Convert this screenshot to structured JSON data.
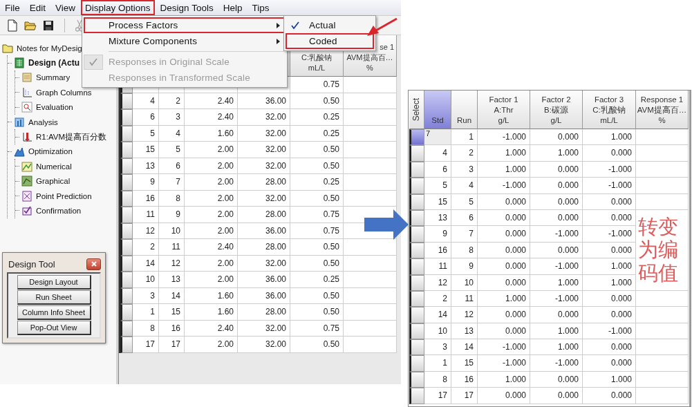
{
  "menu_bar": [
    {
      "label": "File",
      "outlined": false
    },
    {
      "label": "Edit",
      "outlined": false
    },
    {
      "label": "View",
      "outlined": false
    },
    {
      "label": "Display Options",
      "outlined": true
    },
    {
      "label": "Design Tools",
      "outlined": false
    },
    {
      "label": "Help",
      "outlined": false
    },
    {
      "label": "Tips",
      "outlined": false
    }
  ],
  "tree": [
    {
      "label": "Notes for MyDesig",
      "active": false,
      "children": [
        {
          "label": "Design (Actu",
          "active": true,
          "children": [
            {
              "label": "Summary",
              "active": false
            },
            {
              "label": "Graph Columns",
              "active": false
            },
            {
              "label": "Evaluation",
              "active": false
            }
          ]
        },
        {
          "label": "Analysis",
          "active": false,
          "children": [
            {
              "label": "R1:AVM提高百分数",
              "active": false
            }
          ]
        },
        {
          "label": "Optimization",
          "active": false,
          "children": [
            {
              "label": "Numerical",
              "active": false
            },
            {
              "label": "Graphical",
              "active": false
            },
            {
              "label": "Point Prediction",
              "active": false
            },
            {
              "label": "Confirmation",
              "active": false
            }
          ]
        }
      ]
    }
  ],
  "design_tool": {
    "title": "Design Tool",
    "buttons": [
      "Design Layout",
      "Run Sheet",
      "Column Info Sheet",
      "Pop-Out View"
    ]
  },
  "grid": {
    "header": {
      "factor_3": [
        "C:乳酸钠",
        "mL/L"
      ],
      "response_1": [
        "se 1",
        "AVM提高百…",
        "%"
      ]
    },
    "rows": [
      {
        "factor_3": "0.75",
        "selected": false
      },
      {
        "std": "4",
        "run": "2",
        "factor_1": "2.40",
        "factor_2": "36.00",
        "factor_3": "0.50",
        "selected": false
      },
      {
        "std": "6",
        "run": "3",
        "factor_1": "2.40",
        "factor_2": "32.00",
        "factor_3": "0.25",
        "selected": false
      },
      {
        "std": "5",
        "run": "4",
        "factor_1": "1.60",
        "factor_2": "32.00",
        "factor_3": "0.25",
        "selected": false
      },
      {
        "std": "15",
        "run": "5",
        "factor_1": "2.00",
        "factor_2": "32.00",
        "factor_3": "0.50",
        "selected": false
      },
      {
        "std": "13",
        "run": "6",
        "factor_1": "2.00",
        "factor_2": "32.00",
        "factor_3": "0.50",
        "selected": false
      },
      {
        "std": "9",
        "run": "7",
        "factor_1": "2.00",
        "factor_2": "28.00",
        "factor_3": "0.25",
        "selected": false
      },
      {
        "std": "16",
        "run": "8",
        "factor_1": "2.00",
        "factor_2": "32.00",
        "factor_3": "0.50",
        "selected": false
      },
      {
        "std": "11",
        "run": "9",
        "factor_1": "2.00",
        "factor_2": "28.00",
        "factor_3": "0.75",
        "selected": false
      },
      {
        "std": "12",
        "run": "10",
        "factor_1": "2.00",
        "factor_2": "36.00",
        "factor_3": "0.75",
        "selected": false
      },
      {
        "std": "2",
        "run": "11",
        "factor_1": "2.40",
        "factor_2": "28.00",
        "factor_3": "0.50",
        "selected": false
      },
      {
        "std": "14",
        "run": "12",
        "factor_1": "2.00",
        "factor_2": "32.00",
        "factor_3": "0.50",
        "selected": false
      },
      {
        "std": "10",
        "run": "13",
        "factor_1": "2.00",
        "factor_2": "36.00",
        "factor_3": "0.25",
        "selected": false
      },
      {
        "std": "3",
        "run": "14",
        "factor_1": "1.60",
        "factor_2": "36.00",
        "factor_3": "0.50",
        "selected": false
      },
      {
        "std": "1",
        "run": "15",
        "factor_1": "1.60",
        "factor_2": "28.00",
        "factor_3": "0.50",
        "selected": false
      },
      {
        "std": "8",
        "run": "16",
        "factor_1": "2.40",
        "factor_2": "32.00",
        "factor_3": "0.75",
        "selected": false
      },
      {
        "std": "17",
        "run": "17",
        "factor_1": "2.00",
        "factor_2": "32.00",
        "factor_3": "0.50",
        "selected": false
      }
    ]
  },
  "menu": {
    "items": [
      {
        "kind": "item",
        "label": "Process Factors",
        "submenu": true,
        "checked": false,
        "disabled": false,
        "outlined": true
      },
      {
        "kind": "item",
        "label": "Mixture Components",
        "submenu": true,
        "checked": false,
        "disabled": false,
        "outlined": false
      },
      {
        "kind": "separator"
      },
      {
        "kind": "item",
        "label": "Responses in Original Scale",
        "submenu": false,
        "checked": true,
        "disabled": true,
        "outlined": false
      },
      {
        "kind": "item",
        "label": "Responses in Transformed Scale",
        "submenu": false,
        "checked": false,
        "disabled": true,
        "outlined": false
      }
    ]
  },
  "submenu": {
    "items": [
      {
        "kind": "item",
        "label": "Actual",
        "submenu": false,
        "checked": true,
        "disabled": false,
        "outlined": false
      },
      {
        "kind": "item",
        "label": "Coded",
        "submenu": false,
        "checked": false,
        "disabled": false,
        "outlined": true
      }
    ]
  },
  "coded_table": {
    "columns": [
      {
        "kind": "vertical",
        "lines": [
          "Select"
        ],
        "selected": false
      },
      {
        "kind": "text",
        "lines": [
          "Std"
        ],
        "selected": true
      },
      {
        "kind": "text",
        "lines": [
          "Run"
        ],
        "selected": false
      },
      {
        "kind": "text",
        "lines": [
          "Factor 1",
          "A:Thr",
          "g/L"
        ],
        "selected": false
      },
      {
        "kind": "text",
        "lines": [
          "Factor 2",
          "B:碳源",
          "g/L"
        ],
        "selected": false
      },
      {
        "kind": "text",
        "lines": [
          "Factor 3",
          "C:乳酸钠",
          "mL/L"
        ],
        "selected": false
      },
      {
        "kind": "text",
        "lines": [
          "Response 1",
          "AVM提高百…",
          "%"
        ],
        "selected": false
      }
    ],
    "rows": [
      {
        "std": "7",
        "run": "1",
        "factor_1": "-1.000",
        "factor_2": "0.000",
        "factor_3": "1.000",
        "selected": true,
        "editing": true
      },
      {
        "std": "4",
        "run": "2",
        "factor_1": "1.000",
        "factor_2": "1.000",
        "factor_3": "0.000",
        "selected": false,
        "editing": false
      },
      {
        "std": "6",
        "run": "3",
        "factor_1": "1.000",
        "factor_2": "0.000",
        "factor_3": "-1.000",
        "selected": false,
        "editing": false
      },
      {
        "std": "5",
        "run": "4",
        "factor_1": "-1.000",
        "factor_2": "0.000",
        "factor_3": "-1.000",
        "selected": false,
        "editing": false
      },
      {
        "std": "15",
        "run": "5",
        "factor_1": "0.000",
        "factor_2": "0.000",
        "factor_3": "0.000",
        "selected": false,
        "editing": false
      },
      {
        "std": "13",
        "run": "6",
        "factor_1": "0.000",
        "factor_2": "0.000",
        "factor_3": "0.000",
        "selected": false,
        "editing": false
      },
      {
        "std": "9",
        "run": "7",
        "factor_1": "0.000",
        "factor_2": "-1.000",
        "factor_3": "-1.000",
        "selected": false,
        "editing": false
      },
      {
        "std": "16",
        "run": "8",
        "factor_1": "0.000",
        "factor_2": "0.000",
        "factor_3": "0.000",
        "selected": false,
        "editing": false
      },
      {
        "std": "11",
        "run": "9",
        "factor_1": "0.000",
        "factor_2": "-1.000",
        "factor_3": "1.000",
        "selected": false,
        "editing": false
      },
      {
        "std": "12",
        "run": "10",
        "factor_1": "0.000",
        "factor_2": "1.000",
        "factor_3": "1.000",
        "selected": false,
        "editing": false
      },
      {
        "std": "2",
        "run": "11",
        "factor_1": "1.000",
        "factor_2": "-1.000",
        "factor_3": "0.000",
        "selected": false,
        "editing": false
      },
      {
        "std": "14",
        "run": "12",
        "factor_1": "0.000",
        "factor_2": "0.000",
        "factor_3": "0.000",
        "selected": false,
        "editing": false
      },
      {
        "std": "10",
        "run": "13",
        "factor_1": "0.000",
        "factor_2": "1.000",
        "factor_3": "-1.000",
        "selected": false,
        "editing": false
      },
      {
        "std": "3",
        "run": "14",
        "factor_1": "-1.000",
        "factor_2": "1.000",
        "factor_3": "0.000",
        "selected": false,
        "editing": false
      },
      {
        "std": "1",
        "run": "15",
        "factor_1": "-1.000",
        "factor_2": "-1.000",
        "factor_3": "0.000",
        "selected": false,
        "editing": false
      },
      {
        "std": "8",
        "run": "16",
        "factor_1": "1.000",
        "factor_2": "0.000",
        "factor_3": "1.000",
        "selected": false,
        "editing": false
      },
      {
        "std": "17",
        "run": "17",
        "factor_1": "0.000",
        "factor_2": "0.000",
        "factor_3": "0.000",
        "selected": false,
        "editing": false
      }
    ]
  },
  "annotation": {
    "text": "转变为编码值"
  }
}
